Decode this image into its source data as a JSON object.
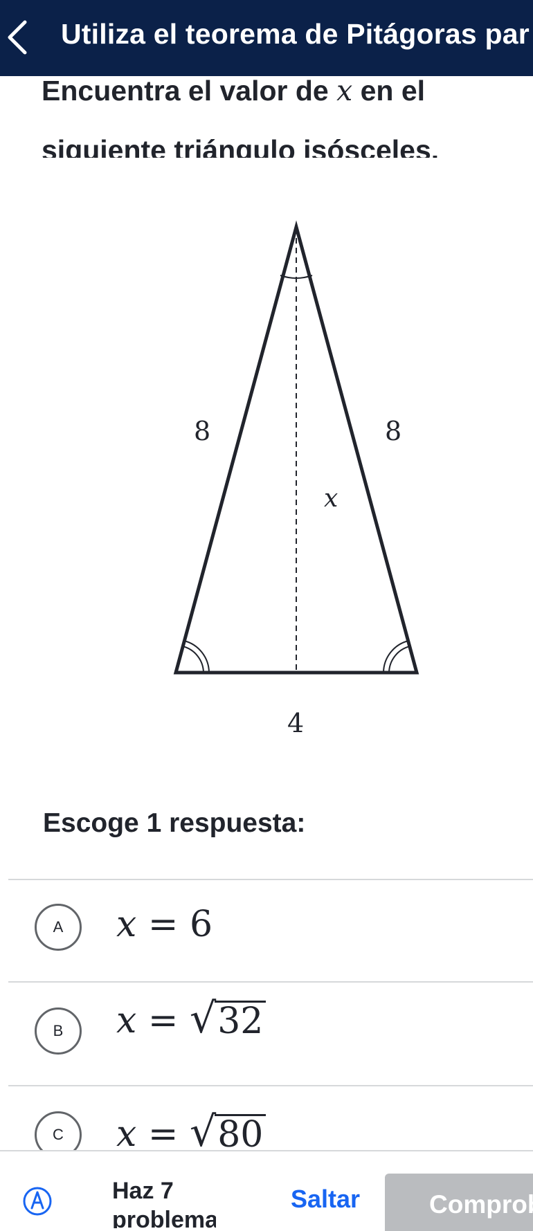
{
  "header": {
    "title": "Utiliza el teorema de Pitágoras par"
  },
  "question": {
    "line1_before": "Encuentra el valor de ",
    "variable": "x",
    "line1_after": " en el",
    "line2": "siguiente triángulo isósceles."
  },
  "figure": {
    "left_side": "8",
    "right_side": "8",
    "height": "x",
    "base": "4"
  },
  "prompt": "Escoge 1 respuesta:",
  "choices": [
    {
      "letter": "A",
      "lhs": "x",
      "eq": " = ",
      "value": "6",
      "radicand": ""
    },
    {
      "letter": "B",
      "lhs": "x",
      "eq": " = ",
      "value": "",
      "radicand": "32"
    },
    {
      "letter": "C",
      "lhs": "x",
      "eq": " = ",
      "value": "",
      "radicand": "80"
    }
  ],
  "footer": {
    "icon": "shield-icon",
    "count_line1": "Haz 7",
    "count_line2": "problemas",
    "skip_label": "Saltar",
    "check_label": "Comprobar"
  },
  "colors": {
    "header_bg": "#0b2149",
    "link_blue": "#1865f2",
    "disabled_button": "#babcbf",
    "text": "#21242c"
  }
}
